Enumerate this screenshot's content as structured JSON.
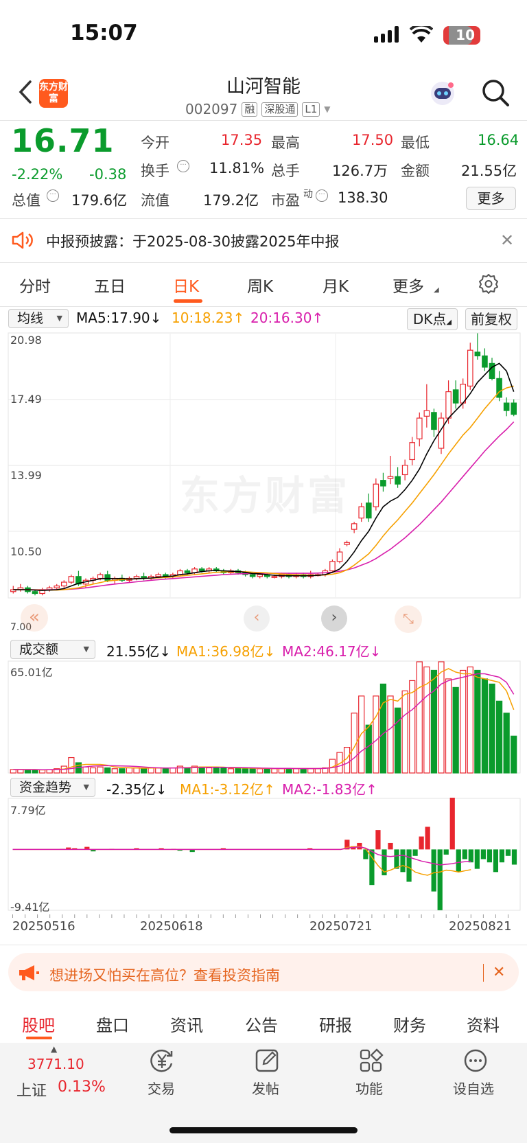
{
  "status_bar": {
    "time": "15:07",
    "battery": "10"
  },
  "header": {
    "logo_text": "东方财富",
    "stock_name": "山河智能",
    "code": "002097",
    "tags": [
      "融",
      "深股通",
      "L1"
    ]
  },
  "quote": {
    "price": "16.71",
    "change_pct": "-2.22%",
    "change": "-0.38",
    "open_label": "今开",
    "open": "17.35",
    "high_label": "最高",
    "high": "17.50",
    "low_label": "最低",
    "low": "16.64",
    "turnover_label": "换手",
    "turnover": "11.81%",
    "volume_label": "总手",
    "volume": "126.7万",
    "amount_label": "金额",
    "amount": "21.55亿",
    "mcap_label": "总值",
    "mcap": "179.6亿",
    "float_label": "流值",
    "float_mcap": "179.2亿",
    "pe_label": "市盈",
    "pe_sup": "动",
    "pe": "138.30",
    "more": "更多"
  },
  "notice": {
    "text": "中报预披露：于2025-08-30披露2025年中报"
  },
  "tabs": [
    "分时",
    "五日",
    "日K",
    "周K",
    "月K",
    "更多"
  ],
  "kline": {
    "ma_select": "均线",
    "ma5": "MA5:17.90",
    "ma10": "10:18.23",
    "ma20": "20:16.30",
    "dk_btn": "DK点",
    "fq_btn": "前复权",
    "watermark": "东方财富",
    "y_labels": [
      "20.98",
      "17.49",
      "13.99",
      "10.50",
      "7.00"
    ]
  },
  "volume": {
    "select": "成交额",
    "value": "21.55亿",
    "ma1": "MA1:36.98亿",
    "ma2": "MA2:46.17亿",
    "max_label": "65.01亿"
  },
  "flow": {
    "select": "资金趋势",
    "value": "-2.35亿",
    "ma1": "MA1:-3.12亿",
    "ma2": "MA2:-1.83亿",
    "max_label": "7.79亿",
    "min_label": "-9.41亿"
  },
  "dates": [
    "20250516",
    "20250618",
    "20250721",
    "20250821"
  ],
  "tip": {
    "text": "想进场又怕买在高位？查看投资指南"
  },
  "bottom_tabs": [
    "股吧",
    "盘口",
    "资讯",
    "公告",
    "研报",
    "财务",
    "资料"
  ],
  "bottom_bar": {
    "index_value": "3771.10",
    "index_name": "上证",
    "index_change": "0.13%",
    "trade": "交易",
    "post": "发帖",
    "func": "功能",
    "fav": "设自选"
  },
  "colors": {
    "up": "#e8262e",
    "down": "#0a9b2c",
    "accent": "#ff5a1e",
    "ma5": "#000000",
    "ma10": "#f6a000",
    "ma20": "#d81dab"
  },
  "chart_data": [
    {
      "type": "candlestick",
      "ylim": [
        7.0,
        20.98
      ],
      "ohlc": [
        [
          7.3,
          7.6,
          7.2,
          7.4
        ],
        [
          7.4,
          7.7,
          7.3,
          7.5
        ],
        [
          7.5,
          7.6,
          7.2,
          7.3
        ],
        [
          7.3,
          7.4,
          7.1,
          7.2
        ],
        [
          7.2,
          7.5,
          7.1,
          7.4
        ],
        [
          7.4,
          7.6,
          7.3,
          7.5
        ],
        [
          7.5,
          7.7,
          7.4,
          7.6
        ],
        [
          7.6,
          7.9,
          7.5,
          7.8
        ],
        [
          7.8,
          8.2,
          7.7,
          8.1
        ],
        [
          8.1,
          8.4,
          7.6,
          7.7
        ],
        [
          7.7,
          8.0,
          7.5,
          7.9
        ],
        [
          7.9,
          8.1,
          7.7,
          8.0
        ],
        [
          8.0,
          8.3,
          7.9,
          8.2
        ],
        [
          8.2,
          8.4,
          7.8,
          7.9
        ],
        [
          7.9,
          8.1,
          7.7,
          8.0
        ],
        [
          8.0,
          8.2,
          7.8,
          7.9
        ],
        [
          7.9,
          8.1,
          7.8,
          8.0
        ],
        [
          8.0,
          8.2,
          7.9,
          8.1
        ],
        [
          8.1,
          8.3,
          7.9,
          8.0
        ],
        [
          8.0,
          8.2,
          7.9,
          8.1
        ],
        [
          8.1,
          8.3,
          8.0,
          8.2
        ],
        [
          8.2,
          8.3,
          8.0,
          8.1
        ],
        [
          8.1,
          8.3,
          8.0,
          8.2
        ],
        [
          8.2,
          8.5,
          8.1,
          8.4
        ],
        [
          8.4,
          8.5,
          8.2,
          8.3
        ],
        [
          8.3,
          8.6,
          8.2,
          8.5
        ],
        [
          8.5,
          8.6,
          8.3,
          8.4
        ],
        [
          8.4,
          8.6,
          8.3,
          8.5
        ],
        [
          8.5,
          8.6,
          8.3,
          8.4
        ],
        [
          8.4,
          8.5,
          8.2,
          8.3
        ],
        [
          8.3,
          8.5,
          8.2,
          8.4
        ],
        [
          8.4,
          8.5,
          8.2,
          8.3
        ],
        [
          8.3,
          8.4,
          8.1,
          8.2
        ],
        [
          8.2,
          8.3,
          8.0,
          8.1
        ],
        [
          8.1,
          8.3,
          8.0,
          8.2
        ],
        [
          8.2,
          8.3,
          8.0,
          8.1
        ],
        [
          8.1,
          8.2,
          8.0,
          8.1
        ],
        [
          8.1,
          8.3,
          8.0,
          8.2
        ],
        [
          8.2,
          8.3,
          8.0,
          8.1
        ],
        [
          8.1,
          8.3,
          8.0,
          8.2
        ],
        [
          8.2,
          8.3,
          8.0,
          8.1
        ],
        [
          8.1,
          8.4,
          8.0,
          8.2
        ],
        [
          8.2,
          8.3,
          8.1,
          8.2
        ],
        [
          8.2,
          8.5,
          8.1,
          8.4
        ],
        [
          8.4,
          9.0,
          8.3,
          8.9
        ],
        [
          8.9,
          9.6,
          8.8,
          9.4
        ],
        [
          9.8,
          10.0,
          9.7,
          9.9
        ],
        [
          10.6,
          11.0,
          10.4,
          10.9
        ],
        [
          11.2,
          12.0,
          11.0,
          11.8
        ],
        [
          12.0,
          12.5,
          11.0,
          11.2
        ],
        [
          11.8,
          13.3,
          11.6,
          13.0
        ],
        [
          13.2,
          13.6,
          12.6,
          12.9
        ],
        [
          13.3,
          14.5,
          13.0,
          13.4
        ],
        [
          13.4,
          13.9,
          12.8,
          13.0
        ],
        [
          13.5,
          14.3,
          13.2,
          14.0
        ],
        [
          14.3,
          15.5,
          14.0,
          15.2
        ],
        [
          15.4,
          16.8,
          15.0,
          16.5
        ],
        [
          16.6,
          18.3,
          16.0,
          16.9
        ],
        [
          16.8,
          17.0,
          15.5,
          15.9
        ],
        [
          14.9,
          16.8,
          14.6,
          16.5
        ],
        [
          16.5,
          18.5,
          16.2,
          17.9
        ],
        [
          18.0,
          18.5,
          17.0,
          17.3
        ],
        [
          17.3,
          18.6,
          17.0,
          18.3
        ],
        [
          18.2,
          20.5,
          18.0,
          20.1
        ],
        [
          20.0,
          21.0,
          19.6,
          19.8
        ],
        [
          19.8,
          20.2,
          19.0,
          19.2
        ],
        [
          19.4,
          19.7,
          18.5,
          18.6
        ],
        [
          18.6,
          19.0,
          17.4,
          17.6
        ],
        [
          17.3,
          17.6,
          16.6,
          16.9
        ],
        [
          17.3,
          17.5,
          16.6,
          16.7
        ]
      ],
      "ma5": [
        7.4,
        7.4,
        7.4,
        7.38,
        7.36,
        7.38,
        7.4,
        7.46,
        7.6,
        7.74,
        7.82,
        7.9,
        7.98,
        8.0,
        7.98,
        8.0,
        7.96,
        7.98,
        8.0,
        8.02,
        8.06,
        8.1,
        8.12,
        8.2,
        8.24,
        8.3,
        8.36,
        8.4,
        8.42,
        8.4,
        8.38,
        8.36,
        8.32,
        8.26,
        8.24,
        8.2,
        8.16,
        8.14,
        8.14,
        8.14,
        8.14,
        8.14,
        8.16,
        8.2,
        8.32,
        8.5,
        8.9,
        9.4,
        10.0,
        10.5,
        11.2,
        11.8,
        12.1,
        12.3,
        12.7,
        13.2,
        13.8,
        14.6,
        15.3,
        15.9,
        16.5,
        16.9,
        17.3,
        17.8,
        18.4,
        18.8,
        19.2,
        19.4,
        19.0,
        17.9
      ],
      "ma10": [
        7.4,
        7.4,
        7.4,
        7.39,
        7.38,
        7.38,
        7.38,
        7.4,
        7.45,
        7.5,
        7.6,
        7.7,
        7.78,
        7.86,
        7.9,
        7.94,
        7.96,
        7.98,
        8.0,
        8.01,
        8.03,
        8.05,
        8.08,
        8.12,
        8.16,
        8.2,
        8.24,
        8.28,
        8.32,
        8.34,
        8.35,
        8.35,
        8.35,
        8.33,
        8.31,
        8.29,
        8.26,
        8.23,
        8.21,
        8.19,
        8.18,
        8.17,
        8.17,
        8.18,
        8.22,
        8.3,
        8.45,
        8.7,
        9.0,
        9.3,
        9.75,
        10.25,
        10.7,
        11.1,
        11.55,
        12.0,
        12.5,
        13.0,
        13.5,
        14.05,
        14.6,
        15.1,
        15.6,
        16.0,
        16.5,
        17.0,
        17.45,
        17.9,
        18.1,
        18.2
      ],
      "ma20": [
        7.4,
        7.4,
        7.4,
        7.4,
        7.4,
        7.4,
        7.4,
        7.41,
        7.43,
        7.46,
        7.5,
        7.55,
        7.6,
        7.65,
        7.7,
        7.74,
        7.78,
        7.82,
        7.86,
        7.9,
        7.93,
        7.96,
        7.99,
        8.02,
        8.05,
        8.08,
        8.11,
        8.14,
        8.17,
        8.2,
        8.22,
        8.24,
        8.25,
        8.26,
        8.27,
        8.27,
        8.27,
        8.27,
        8.27,
        8.27,
        8.27,
        8.27,
        8.28,
        8.3,
        8.33,
        8.38,
        8.45,
        8.55,
        8.7,
        8.85,
        9.05,
        9.3,
        9.55,
        9.85,
        10.15,
        10.5,
        10.85,
        11.25,
        11.65,
        12.05,
        12.5,
        12.95,
        13.4,
        13.85,
        14.3,
        14.75,
        15.15,
        15.55,
        15.9,
        16.3
      ]
    },
    {
      "type": "bar",
      "name": "成交额",
      "ylim": [
        0,
        65.01
      ],
      "values": [
        2,
        2,
        1.5,
        1.5,
        1.8,
        2,
        2.5,
        4,
        9,
        6,
        3.5,
        3,
        3.5,
        3,
        2.5,
        2.5,
        3,
        3,
        2.5,
        3,
        3,
        2.5,
        3,
        4,
        3,
        4,
        3.5,
        3,
        3,
        3,
        2.5,
        3,
        2.5,
        2.5,
        2.5,
        2.5,
        2.5,
        2.5,
        2.5,
        2.5,
        2.5,
        2.5,
        2.5,
        3,
        8,
        12,
        15,
        35,
        45,
        28,
        45,
        52,
        45,
        38,
        48,
        54,
        65,
        62,
        60,
        65,
        55,
        50,
        60,
        62,
        60,
        55,
        52,
        42,
        35,
        21.55
      ],
      "ma1": [
        2,
        2,
        2,
        2,
        1.8,
        1.9,
        2,
        2.3,
        3.5,
        4.5,
        5,
        5,
        5,
        4.5,
        3.5,
        3.2,
        3,
        2.9,
        2.8,
        2.9,
        2.9,
        2.9,
        2.9,
        3.1,
        3.1,
        3.3,
        3.5,
        3.5,
        3.5,
        3.4,
        3.1,
        3,
        2.9,
        2.8,
        2.7,
        2.7,
        2.6,
        2.6,
        2.6,
        2.6,
        2.6,
        2.6,
        2.6,
        2.7,
        3.5,
        5.5,
        8.5,
        15,
        23,
        27,
        33,
        41,
        43,
        42,
        46,
        47,
        50,
        52,
        55,
        59,
        61,
        59,
        58,
        58,
        56,
        55,
        54,
        53,
        48,
        37
      ],
      "ma2": [
        2,
        2,
        2,
        2,
        1.9,
        1.9,
        2,
        2.1,
        2.6,
        3.2,
        3.6,
        4,
        4.2,
        4.3,
        4.2,
        4.1,
        4,
        3.8,
        3.5,
        3.2,
        3,
        2.9,
        2.9,
        3,
        3,
        3.1,
        3.2,
        3.3,
        3.3,
        3.3,
        3.3,
        3.2,
        3.1,
        3,
        2.9,
        2.8,
        2.7,
        2.7,
        2.7,
        2.6,
        2.6,
        2.6,
        2.6,
        2.7,
        3.1,
        4.1,
        5.6,
        8.8,
        12.8,
        15.7,
        19,
        23,
        26,
        30,
        34,
        37,
        41,
        45,
        48,
        52,
        54,
        55,
        56,
        57,
        58,
        58,
        57,
        56,
        53,
        46
      ]
    },
    {
      "type": "bar",
      "name": "资金趋势",
      "ylim": [
        -9.41,
        7.79
      ],
      "values": [
        0,
        0,
        0,
        0,
        0,
        0,
        0,
        0,
        0.1,
        0.3,
        0.2,
        0,
        0.4,
        -0.3,
        0,
        0,
        0.1,
        0,
        0,
        0,
        0.2,
        0,
        0,
        0,
        0.2,
        0,
        0.1,
        -0.2,
        0,
        -0.4,
        0,
        0,
        0,
        0,
        0.2,
        0,
        0,
        0,
        0,
        0,
        0,
        0,
        0,
        0,
        0,
        0,
        0,
        0,
        0.2,
        0,
        0,
        0,
        0,
        0,
        1.5,
        0.5,
        1,
        -1.5,
        -5.5,
        3,
        -4,
        1,
        -3,
        -3.5,
        -5,
        -1,
        2,
        3.5,
        -6.5,
        -9.4,
        -0.8,
        8,
        -3.5,
        -1.5,
        -2,
        -3,
        -1.5,
        -2,
        -3.5,
        -2,
        -1,
        -2.35
      ],
      "ma1": [
        0,
        0,
        0,
        0,
        0,
        0,
        0,
        0,
        0,
        0,
        0,
        0,
        0,
        0,
        0,
        0,
        0,
        0,
        0,
        0,
        0,
        0,
        0,
        0,
        0,
        0,
        0,
        0,
        0,
        0,
        0,
        0,
        0,
        0,
        0,
        0,
        0,
        0,
        0,
        0,
        0,
        0,
        0,
        0,
        0,
        0,
        0,
        0,
        0,
        0,
        0,
        0,
        0,
        0,
        0.3,
        0.4,
        0.5,
        0.1,
        -1.2,
        -2.5,
        -3.5,
        -3.2,
        -2.8,
        -2.5,
        -2.8,
        -3.5,
        -3.8,
        -4,
        -3.6,
        -3.5,
        -3.2,
        -3.3,
        -3.5,
        -3.3,
        -3.12
      ],
      "ma2": [
        0,
        0,
        0,
        0,
        0,
        0,
        0,
        0,
        0,
        0,
        0,
        0,
        0,
        0,
        0,
        0,
        0,
        0,
        0,
        0,
        0,
        0,
        0,
        0,
        0,
        0,
        0,
        0,
        0,
        0,
        0,
        0,
        0,
        0,
        0,
        0,
        0,
        0,
        0,
        0,
        0,
        0,
        0,
        0,
        0,
        0,
        0,
        0,
        0,
        0,
        0,
        0,
        0,
        0,
        0.2,
        0.3,
        0.4,
        0.2,
        -0.3,
        -0.8,
        -1,
        -1.1,
        -1,
        -0.9,
        -1.2,
        -1.5,
        -1.8,
        -2,
        -2.2,
        -2.4,
        -2.3,
        -2.2,
        -2,
        -1.9,
        -1.83
      ]
    }
  ]
}
